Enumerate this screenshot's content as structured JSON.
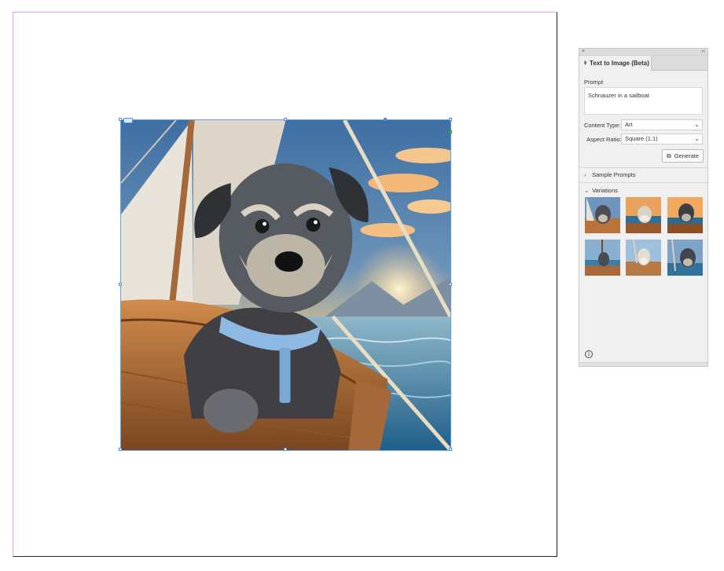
{
  "panel": {
    "close_glyph": "×",
    "collapse_glyph": "‹‹",
    "tab_title": "Text to Image (Beta)",
    "prompt_label": "Prompt",
    "prompt_value": "Schnauzer in a sailboat",
    "content_type_label": "Content Type:",
    "content_type_value": "Art",
    "aspect_ratio_label": "Aspect Ratio:",
    "aspect_ratio_value": "Square (1:1)",
    "generate_label": "Generate",
    "sample_prompts_label": "Sample Prompts",
    "variations_label": "Variations",
    "variation_count": 6,
    "info_glyph": "i"
  },
  "icons": {
    "close": "close-icon",
    "collapse": "collapse-panel-icon",
    "tab_arrows": "up-down-icon",
    "chevron": "chevron-down-icon",
    "generate": "generate-icon",
    "expand": "chevron-right-icon",
    "info": "info-icon"
  },
  "colors": {
    "selection": "#4a90e2",
    "page_bleed": "#d9a6e2",
    "panel_bg": "#f0f0f0",
    "sky": "#4d7fb0",
    "sea": "#3a7ea8",
    "boat": "#b9733a"
  }
}
